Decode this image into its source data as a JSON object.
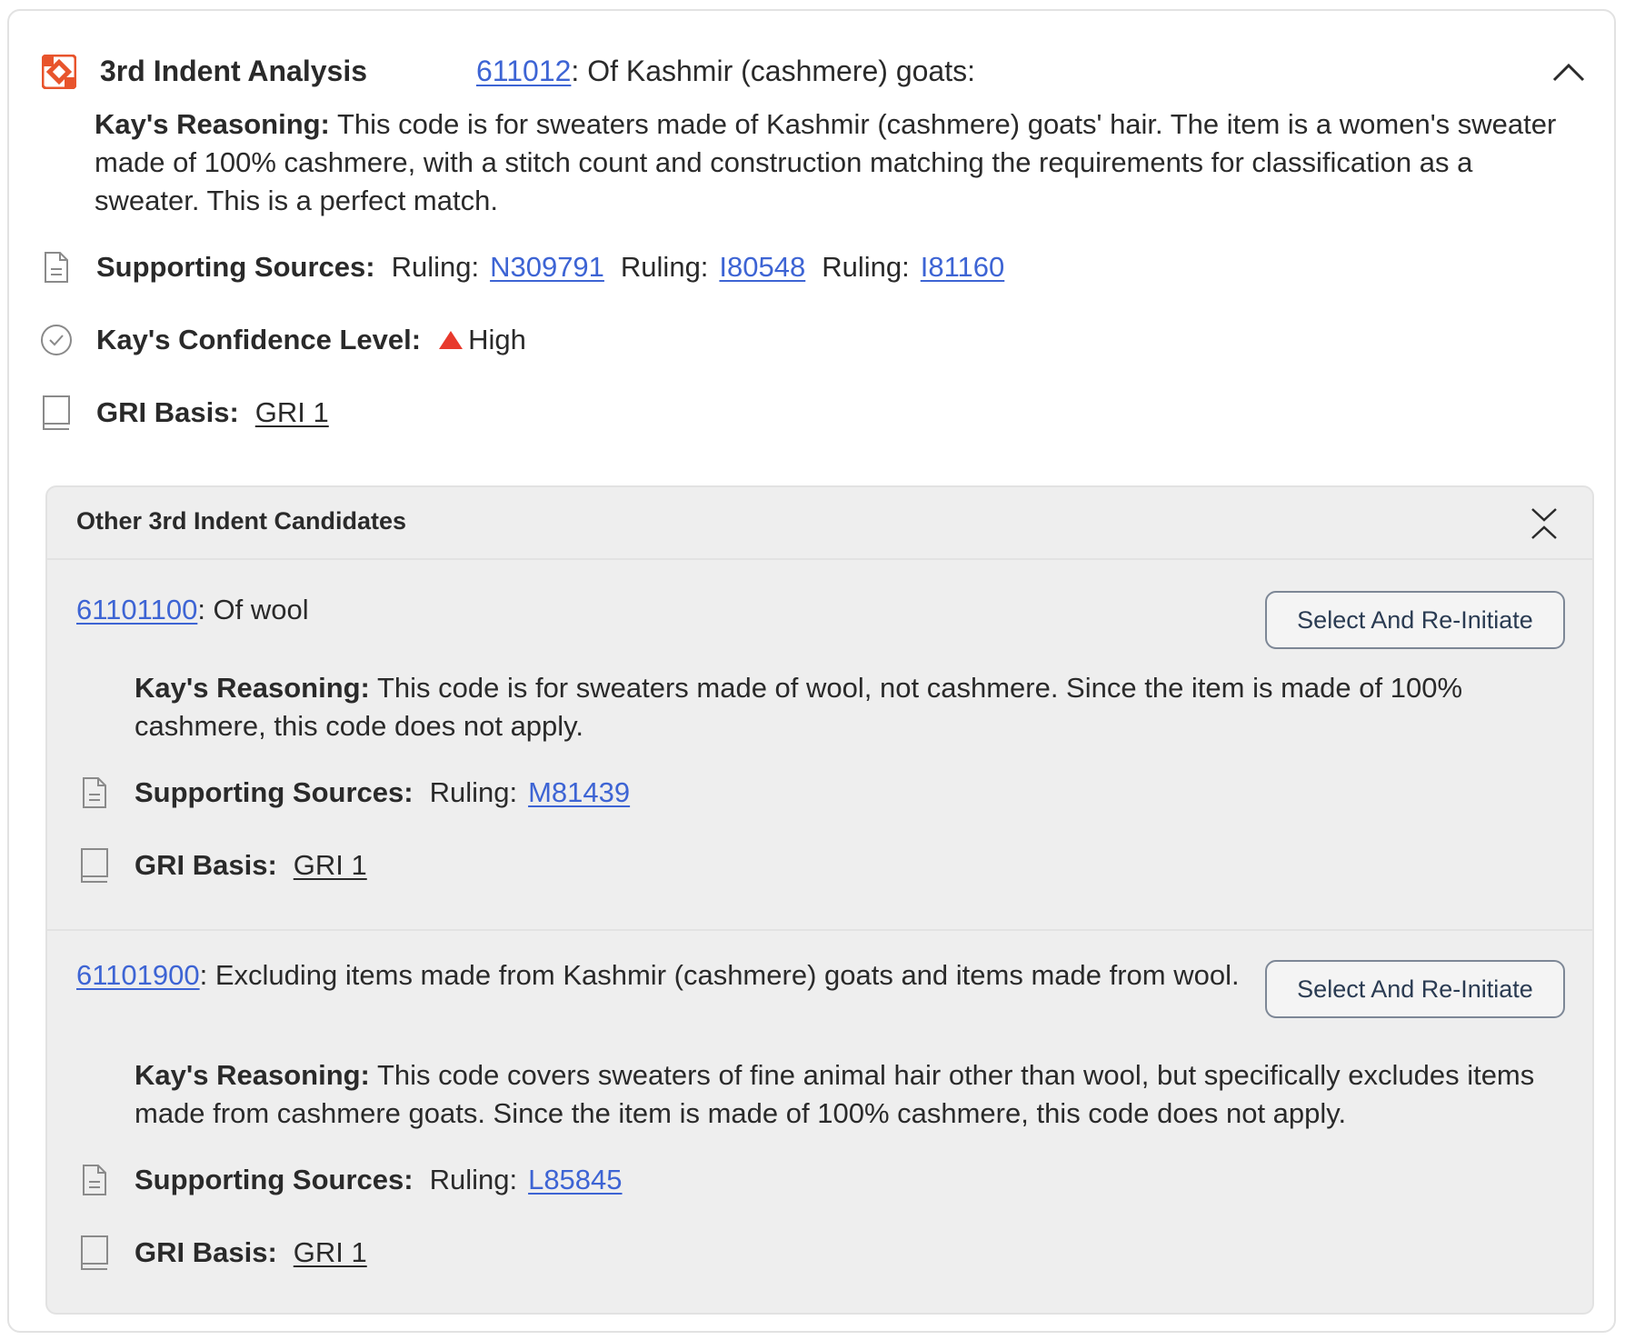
{
  "header": {
    "title": "3rd Indent Analysis",
    "code": "611012",
    "code_desc": ": Of Kashmir (cashmere) goats:"
  },
  "main": {
    "reasoning_label": "Kay's Reasoning:",
    "reasoning_text": " This code is for sweaters made of Kashmir (cashmere) goats' hair. The item is a women's sweater made of 100% cashmere, with a stitch count and construction matching the requirements for classification as a sweater. This is a perfect match.",
    "sources_label": "Supporting Sources:",
    "sources": [
      {
        "prefix": "Ruling:",
        "id": "N309791"
      },
      {
        "prefix": "Ruling:",
        "id": "I80548"
      },
      {
        "prefix": "Ruling:",
        "id": "I81160"
      }
    ],
    "confidence_label": "Kay's Confidence Level:",
    "confidence_value": "High",
    "confidence_color": "#e8392c",
    "gri_label": "GRI Basis:",
    "gri_value": "GRI 1"
  },
  "panel": {
    "title": "Other 3rd Indent Candidates",
    "candidates": [
      {
        "code": "61101100",
        "desc": ": Of wool",
        "button": "Select And Re-Initiate",
        "reasoning_label": "Kay's Reasoning:",
        "reasoning_text": " This code is for sweaters made of wool, not cashmere. Since the item is made of 100% cashmere, this code does not apply.",
        "sources_label": "Supporting Sources:",
        "source_prefix": "Ruling:",
        "source_id": "M81439",
        "gri_label": "GRI Basis:",
        "gri_value": "GRI 1"
      },
      {
        "code": "61101900",
        "desc": ": Excluding items made from Kashmir (cashmere) goats and items made from wool.",
        "button": "Select And Re-Initiate",
        "reasoning_label": "Kay's Reasoning:",
        "reasoning_text": " This code covers sweaters of fine animal hair other than wool, but specifically excludes items made from cashmere goats. Since the item is made of 100% cashmere, this code does not apply.",
        "sources_label": "Supporting Sources:",
        "source_prefix": "Ruling:",
        "source_id": "L85845",
        "gri_label": "GRI Basis:",
        "gri_value": "GRI 1"
      }
    ]
  },
  "colors": {
    "link": "#3d64d4",
    "brand": "#e8542c",
    "panel_bg": "#eeeeee"
  },
  "icons": [
    "brand-logo-icon",
    "chevron-up-icon",
    "document-icon",
    "check-circle-icon",
    "triangle-up-icon",
    "book-icon",
    "collapse-icon"
  ]
}
